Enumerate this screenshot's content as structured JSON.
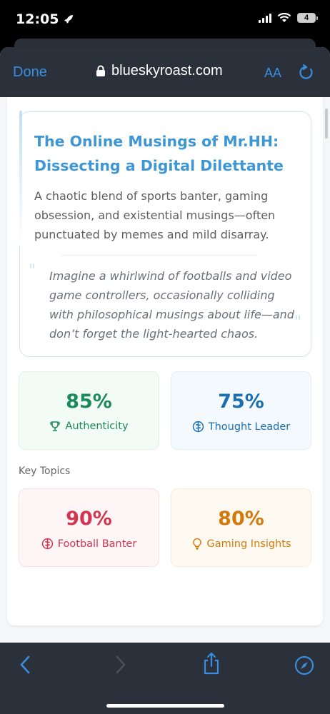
{
  "status_bar": {
    "time": "12:05",
    "battery": "4"
  },
  "browser": {
    "done_label": "Done",
    "url": "blueskyroast.com",
    "text_size_label": "AA"
  },
  "hero": {
    "title": "The Online Musings of Mr.HH: Dissecting a Digital Dilettante",
    "description": "A chaotic blend of sports banter, gaming obsession, and existential musings—often punctuated by memes and mild disarray.",
    "quote": "Imagine a whirlwind of footballs and video game controllers, occasionally colliding with philosophical musings about life—and don’t forget the light-hearted chaos."
  },
  "stats": [
    {
      "value": "85%",
      "label": "Authenticity",
      "icon": "trophy-icon",
      "color": "#1b8a5a"
    },
    {
      "value": "75%",
      "label": "Thought Leader",
      "icon": "brain-icon",
      "color": "#1d6fb0"
    }
  ],
  "key_topics": {
    "label": "Key Topics",
    "items": [
      {
        "value": "90%",
        "label": "Football Banter",
        "icon": "brain-icon",
        "color": "#d33550"
      },
      {
        "value": "80%",
        "label": "Gaming Insights",
        "icon": "lightbulb-icon",
        "color": "#d4790b"
      }
    ]
  },
  "colors": {
    "accent": "#3a8dde",
    "title_blue": "#3d97d6",
    "toolbar_bg": "#2b313b"
  }
}
